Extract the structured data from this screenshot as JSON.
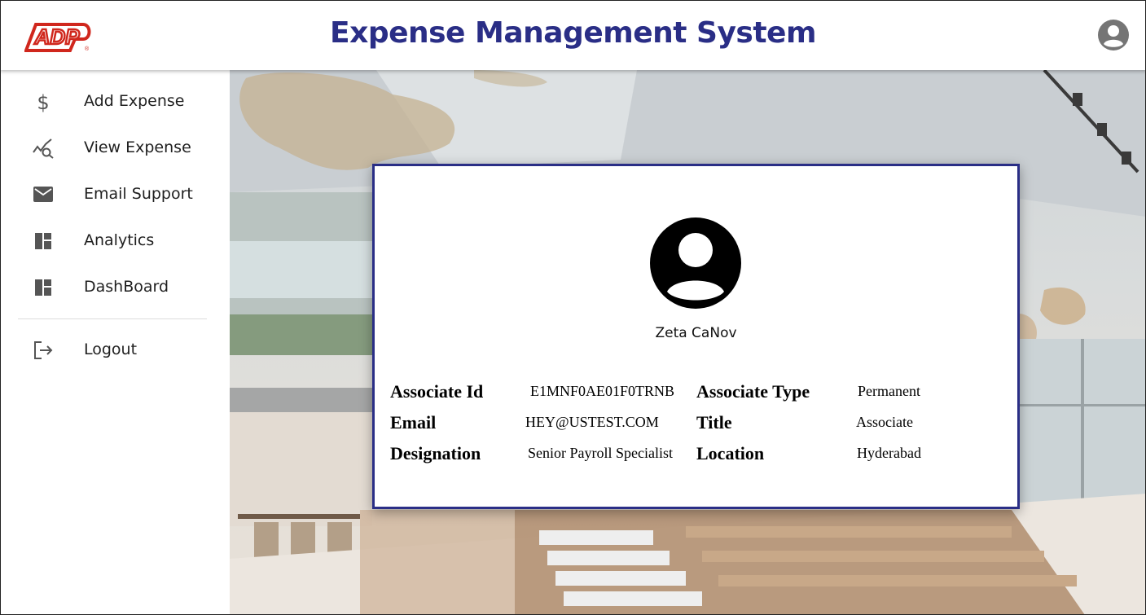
{
  "header": {
    "logo_text": "ADP",
    "title": "Expense Management System",
    "profile_icon": "account-circle-icon"
  },
  "sidebar": {
    "items": [
      {
        "label": "Add Expense",
        "icon": "dollar-icon"
      },
      {
        "label": "View Expense",
        "icon": "chart-search-icon"
      },
      {
        "label": "Email Support",
        "icon": "mail-icon"
      },
      {
        "label": "Analytics",
        "icon": "dashboard-icon"
      },
      {
        "label": "DashBoard",
        "icon": "dashboard-icon"
      }
    ],
    "logout": {
      "label": "Logout",
      "icon": "logout-icon"
    }
  },
  "profile": {
    "name": "Zeta CaNov",
    "fields": {
      "associate_id_label": "Associate Id",
      "associate_id_value": "E1MNF0AE01F0TRNB",
      "email_label": "Email",
      "email_value": "HEY@USTEST.COM",
      "designation_label": "Designation",
      "designation_value": "Senior Payroll Specialist",
      "associate_type_label": "Associate Type",
      "associate_type_value": "Permanent",
      "title_label": "Title",
      "title_value": "Associate",
      "location_label": "Location",
      "location_value": "Hyderabad"
    }
  },
  "colors": {
    "brand_navy": "#2a2e86",
    "logo_red": "#d0271d"
  }
}
